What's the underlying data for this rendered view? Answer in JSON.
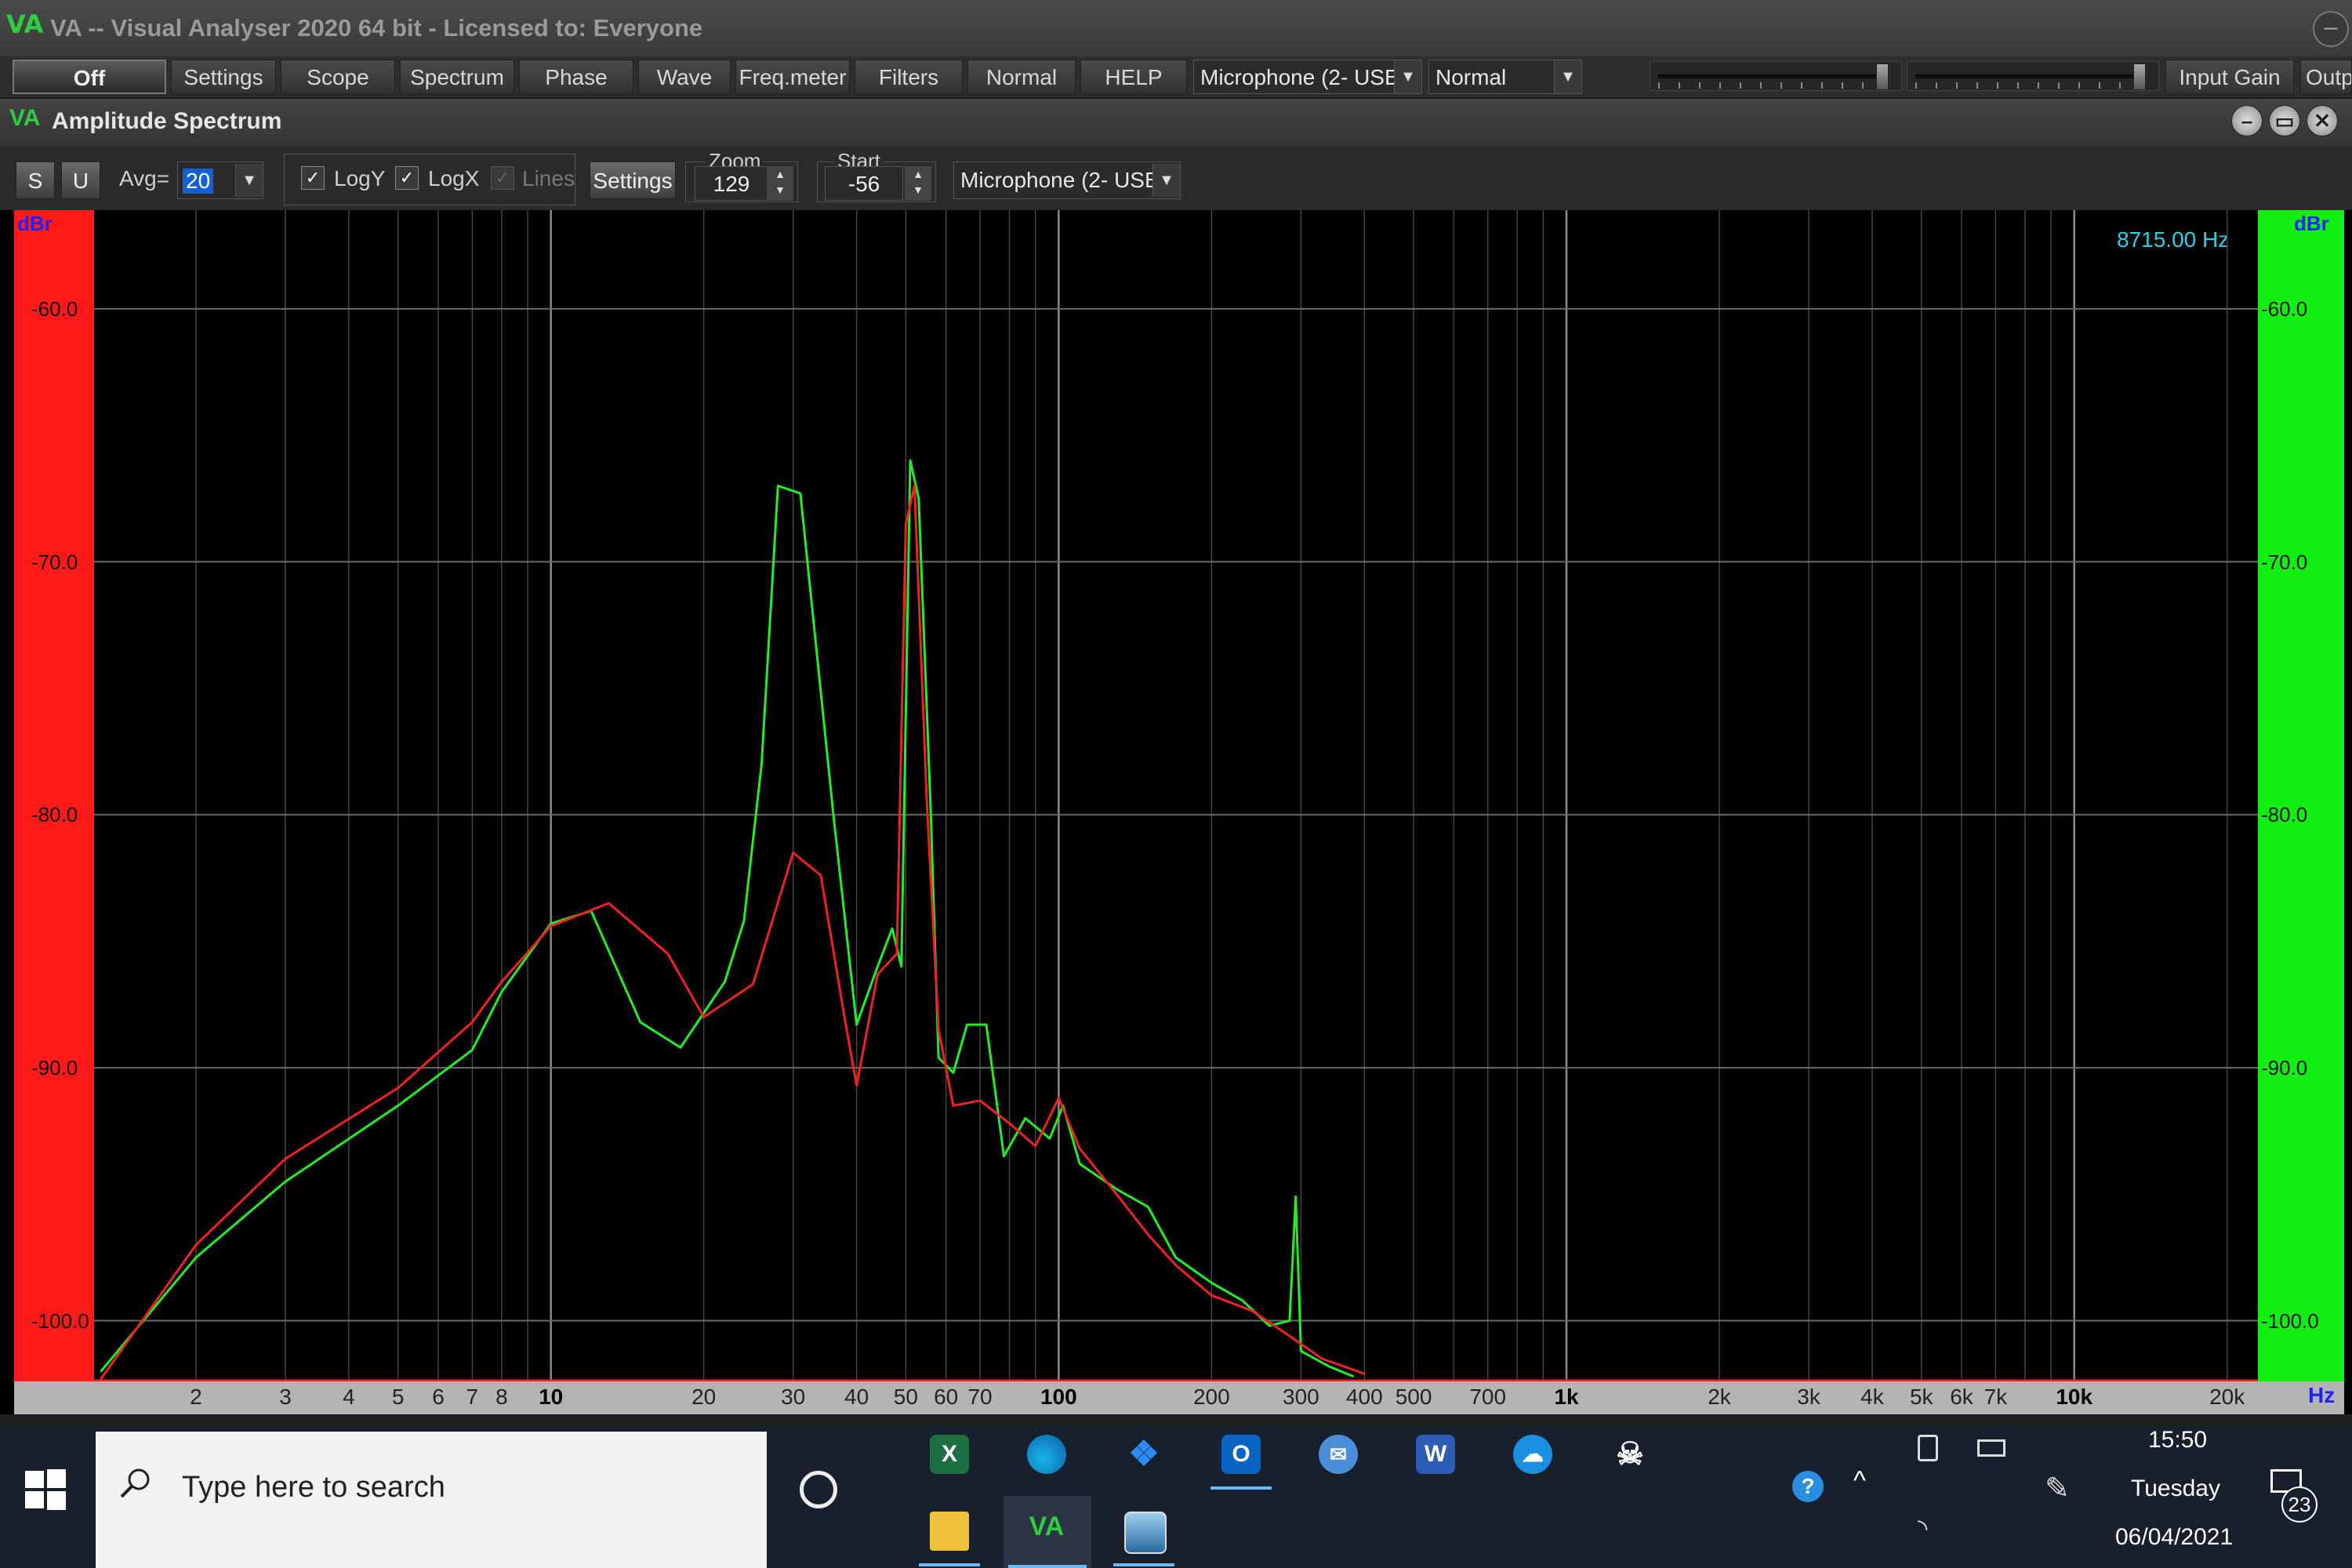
{
  "window": {
    "title": "VA -- Visual Analyser 2020 64 bit - Licensed to: Everyone",
    "icon_text": "VA",
    "minimize_glyph": "–"
  },
  "toolbar": {
    "off": "Off",
    "settings": "Settings",
    "scope": "Scope",
    "spectrum": "Spectrum",
    "phase": "Phase",
    "wave": "Wave",
    "freqmeter": "Freq.meter",
    "filters": "Filters",
    "normal_btn": "Normal",
    "help": "HELP",
    "input_device": "Microphone (2- USB",
    "mode_select": "Normal",
    "input_gain": "Input Gain",
    "output_gain": "Outp"
  },
  "child": {
    "title": "Amplitude Spectrum",
    "min": "–",
    "max": "▭",
    "close": "✕"
  },
  "spectrum_toolbar": {
    "s": "S",
    "u": "U",
    "avg_label": "Avg=",
    "avg_value": "20",
    "logy": "LogY",
    "logx": "LogX",
    "lines": "Lines",
    "settings": "Settings",
    "zoom_label": "Zoom",
    "zoom_value": "129",
    "start_label": "Start",
    "start_value": "-56",
    "device": "Microphone (2- USB",
    "logy_checked": true,
    "logx_checked": true,
    "lines_checked": false
  },
  "plot": {
    "left_unit": "dBr",
    "right_unit": "dBr",
    "freq_readout": "8715.00 Hz",
    "hz_unit": "Hz",
    "left_color": "#ff1a1a",
    "right_color": "#13ee13",
    "y_ticks": [
      "-60.0",
      "-70.0",
      "-80.0",
      "-90.0",
      "-100.0"
    ],
    "x_ticks": [
      "2",
      "3",
      "4",
      "5",
      "6",
      "7",
      "8",
      "10",
      "20",
      "30",
      "40",
      "50",
      "60",
      "70",
      "100",
      "200",
      "300",
      "400",
      "500",
      "700",
      "1k",
      "2k",
      "3k",
      "4k",
      "5k",
      "6k",
      "7k",
      "10k",
      "20k"
    ]
  },
  "chart_data": {
    "type": "line",
    "title": "",
    "xlabel": "Hz",
    "ylabel": "dBr",
    "x_scale": "log",
    "xlim": [
      1.26,
      23000
    ],
    "ylim": [
      -102.4,
      -56.1
    ],
    "grid": true,
    "series": [
      {
        "color": "#22ee22",
        "points": [
          [
            1.3,
            -102
          ],
          [
            2,
            -97.5
          ],
          [
            3,
            -94.5
          ],
          [
            5,
            -91.5
          ],
          [
            7,
            -89.3
          ],
          [
            8,
            -87
          ],
          [
            10,
            -84.3
          ],
          [
            12,
            -83.8
          ],
          [
            15,
            -88.2
          ],
          [
            18,
            -89.2
          ],
          [
            22,
            -86.6
          ],
          [
            24,
            -84.2
          ],
          [
            26,
            -78
          ],
          [
            28,
            -67
          ],
          [
            31,
            -67.3
          ],
          [
            36,
            -80
          ],
          [
            40,
            -88.3
          ],
          [
            44,
            -86
          ],
          [
            47,
            -84.5
          ],
          [
            49,
            -86
          ],
          [
            51,
            -66
          ],
          [
            53,
            -67.5
          ],
          [
            56,
            -80
          ],
          [
            58,
            -89.6
          ],
          [
            62,
            -90.2
          ],
          [
            66,
            -88.3
          ],
          [
            72,
            -88.3
          ],
          [
            78,
            -93.5
          ],
          [
            86,
            -92
          ],
          [
            96,
            -92.8
          ],
          [
            102,
            -91.5
          ],
          [
            110,
            -93.8
          ],
          [
            130,
            -94.8
          ],
          [
            150,
            -95.5
          ],
          [
            170,
            -97.5
          ],
          [
            200,
            -98.5
          ],
          [
            230,
            -99.2
          ],
          [
            260,
            -100.2
          ],
          [
            285,
            -100
          ],
          [
            293,
            -95.1
          ],
          [
            300,
            -101.2
          ],
          [
            340,
            -101.8
          ],
          [
            380,
            -102.2
          ]
        ]
      },
      {
        "color": "#ee2222",
        "points": [
          [
            1.3,
            -102.3
          ],
          [
            2,
            -97
          ],
          [
            3,
            -93.6
          ],
          [
            5,
            -90.8
          ],
          [
            7,
            -88.2
          ],
          [
            8,
            -86.6
          ],
          [
            10,
            -84.4
          ],
          [
            13,
            -83.5
          ],
          [
            17,
            -85.5
          ],
          [
            20,
            -88
          ],
          [
            25,
            -86.7
          ],
          [
            30,
            -81.5
          ],
          [
            34,
            -82.4
          ],
          [
            38,
            -88.2
          ],
          [
            40,
            -90.7
          ],
          [
            44,
            -86.3
          ],
          [
            48,
            -85.5
          ],
          [
            50,
            -68.5
          ],
          [
            52,
            -67
          ],
          [
            55,
            -79.5
          ],
          [
            58,
            -88.5
          ],
          [
            62,
            -91.5
          ],
          [
            70,
            -91.3
          ],
          [
            80,
            -92.2
          ],
          [
            90,
            -93.1
          ],
          [
            100,
            -91.2
          ],
          [
            110,
            -93.2
          ],
          [
            130,
            -95
          ],
          [
            150,
            -96.6
          ],
          [
            170,
            -97.8
          ],
          [
            200,
            -99
          ],
          [
            240,
            -99.6
          ],
          [
            280,
            -100.5
          ],
          [
            330,
            -101.5
          ],
          [
            400,
            -102.1
          ]
        ]
      }
    ]
  },
  "taskbar": {
    "search_placeholder": "Type here to search",
    "time": "15:50",
    "day": "Tuesday",
    "date": "06/04/2021",
    "notifications": "23",
    "excel": "X",
    "outlook": "O",
    "word": "W",
    "va": "VA"
  }
}
